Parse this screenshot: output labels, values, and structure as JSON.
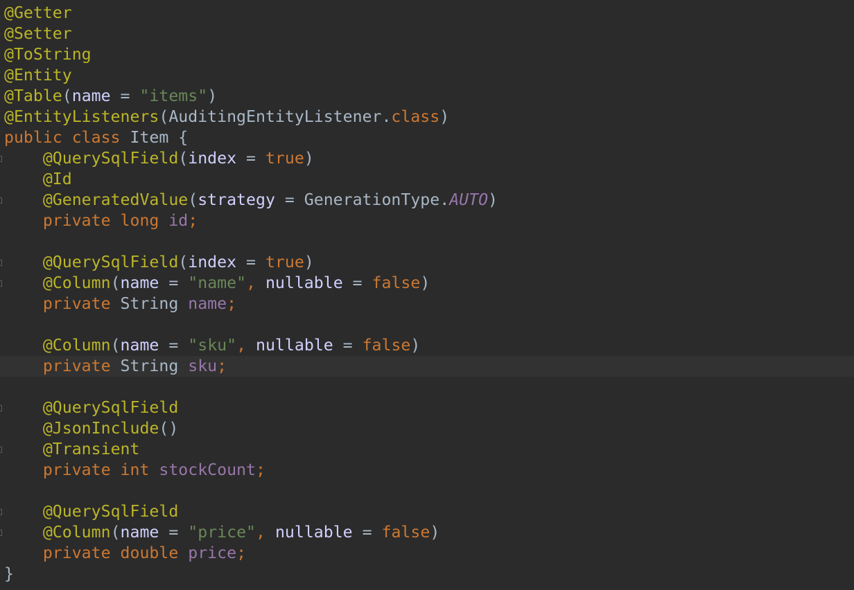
{
  "editor": {
    "lines": [
      {
        "tokens": [
          {
            "t": "@Getter",
            "c": "ann"
          }
        ]
      },
      {
        "tokens": [
          {
            "t": "@Setter",
            "c": "ann"
          }
        ]
      },
      {
        "tokens": [
          {
            "t": "@ToString",
            "c": "ann"
          }
        ]
      },
      {
        "tokens": [
          {
            "t": "@Entity",
            "c": "ann"
          }
        ]
      },
      {
        "tokens": [
          {
            "t": "@Table",
            "c": "ann"
          },
          {
            "t": "(",
            "c": "plain"
          },
          {
            "t": "name",
            "c": "param"
          },
          {
            "t": " = ",
            "c": "plain"
          },
          {
            "t": "\"items\"",
            "c": "str"
          },
          {
            "t": ")",
            "c": "plain"
          }
        ]
      },
      {
        "tokens": [
          {
            "t": "@EntityListeners",
            "c": "ann"
          },
          {
            "t": "(AuditingEntityListener.",
            "c": "plain"
          },
          {
            "t": "class",
            "c": "kw"
          },
          {
            "t": ")",
            "c": "plain"
          }
        ]
      },
      {
        "tokens": [
          {
            "t": "public class ",
            "c": "kw"
          },
          {
            "t": "Item {",
            "c": "plain"
          }
        ]
      },
      {
        "fold": true,
        "tokens": [
          {
            "t": "    ",
            "c": "plain"
          },
          {
            "t": "@QuerySqlField",
            "c": "ann"
          },
          {
            "t": "(",
            "c": "plain"
          },
          {
            "t": "index",
            "c": "param"
          },
          {
            "t": " = ",
            "c": "plain"
          },
          {
            "t": "true",
            "c": "kw"
          },
          {
            "t": ")",
            "c": "plain"
          }
        ]
      },
      {
        "tokens": [
          {
            "t": "    ",
            "c": "plain"
          },
          {
            "t": "@Id",
            "c": "ann"
          }
        ]
      },
      {
        "fold": true,
        "tokens": [
          {
            "t": "    ",
            "c": "plain"
          },
          {
            "t": "@GeneratedValue",
            "c": "ann"
          },
          {
            "t": "(",
            "c": "plain"
          },
          {
            "t": "strategy",
            "c": "param"
          },
          {
            "t": " = GenerationType.",
            "c": "plain"
          },
          {
            "t": "AUTO",
            "c": "const"
          },
          {
            "t": ")",
            "c": "plain"
          }
        ]
      },
      {
        "tokens": [
          {
            "t": "    ",
            "c": "plain"
          },
          {
            "t": "private long ",
            "c": "kw"
          },
          {
            "t": "id",
            "c": "fld"
          },
          {
            "t": ";",
            "c": "kw"
          }
        ]
      },
      {
        "tokens": []
      },
      {
        "fold": true,
        "tokens": [
          {
            "t": "    ",
            "c": "plain"
          },
          {
            "t": "@QuerySqlField",
            "c": "ann"
          },
          {
            "t": "(",
            "c": "plain"
          },
          {
            "t": "index",
            "c": "param"
          },
          {
            "t": " = ",
            "c": "plain"
          },
          {
            "t": "true",
            "c": "kw"
          },
          {
            "t": ")",
            "c": "plain"
          }
        ]
      },
      {
        "fold": true,
        "tokens": [
          {
            "t": "    ",
            "c": "plain"
          },
          {
            "t": "@Column",
            "c": "ann"
          },
          {
            "t": "(",
            "c": "plain"
          },
          {
            "t": "name",
            "c": "param"
          },
          {
            "t": " = ",
            "c": "plain"
          },
          {
            "t": "\"name\"",
            "c": "str"
          },
          {
            "t": ", ",
            "c": "kw"
          },
          {
            "t": "nullable",
            "c": "param"
          },
          {
            "t": " = ",
            "c": "plain"
          },
          {
            "t": "false",
            "c": "kw"
          },
          {
            "t": ")",
            "c": "plain"
          }
        ]
      },
      {
        "tokens": [
          {
            "t": "    ",
            "c": "plain"
          },
          {
            "t": "private ",
            "c": "kw"
          },
          {
            "t": "String ",
            "c": "plain"
          },
          {
            "t": "name",
            "c": "fld"
          },
          {
            "t": ";",
            "c": "kw"
          }
        ]
      },
      {
        "tokens": []
      },
      {
        "tokens": [
          {
            "t": "    ",
            "c": "plain"
          },
          {
            "t": "@Column",
            "c": "ann"
          },
          {
            "t": "(",
            "c": "plain"
          },
          {
            "t": "name",
            "c": "param"
          },
          {
            "t": " = ",
            "c": "plain"
          },
          {
            "t": "\"sku\"",
            "c": "str"
          },
          {
            "t": ", ",
            "c": "kw"
          },
          {
            "t": "nullable",
            "c": "param"
          },
          {
            "t": " = ",
            "c": "plain"
          },
          {
            "t": "false",
            "c": "kw"
          },
          {
            "t": ")",
            "c": "plain"
          }
        ]
      },
      {
        "current": true,
        "tokens": [
          {
            "t": "    ",
            "c": "plain"
          },
          {
            "t": "private ",
            "c": "kw"
          },
          {
            "t": "String ",
            "c": "plain"
          },
          {
            "t": "sku",
            "c": "fld"
          },
          {
            "t": ";",
            "c": "kw"
          }
        ]
      },
      {
        "tokens": []
      },
      {
        "fold": true,
        "tokens": [
          {
            "t": "    ",
            "c": "plain"
          },
          {
            "t": "@QuerySqlField",
            "c": "ann"
          }
        ]
      },
      {
        "tokens": [
          {
            "t": "    ",
            "c": "plain"
          },
          {
            "t": "@JsonInclude",
            "c": "ann"
          },
          {
            "t": "()",
            "c": "plain"
          }
        ]
      },
      {
        "fold": true,
        "tokens": [
          {
            "t": "    ",
            "c": "plain"
          },
          {
            "t": "@Transient",
            "c": "ann"
          }
        ]
      },
      {
        "tokens": [
          {
            "t": "    ",
            "c": "plain"
          },
          {
            "t": "private int ",
            "c": "kw"
          },
          {
            "t": "stockCount",
            "c": "fld"
          },
          {
            "t": ";",
            "c": "kw"
          }
        ]
      },
      {
        "tokens": []
      },
      {
        "fold": true,
        "tokens": [
          {
            "t": "    ",
            "c": "plain"
          },
          {
            "t": "@QuerySqlField",
            "c": "ann"
          }
        ]
      },
      {
        "fold": true,
        "tokens": [
          {
            "t": "    ",
            "c": "plain"
          },
          {
            "t": "@Column",
            "c": "ann"
          },
          {
            "t": "(",
            "c": "plain"
          },
          {
            "t": "name",
            "c": "param"
          },
          {
            "t": " = ",
            "c": "plain"
          },
          {
            "t": "\"price\"",
            "c": "str"
          },
          {
            "t": ", ",
            "c": "kw"
          },
          {
            "t": "nullable",
            "c": "param"
          },
          {
            "t": " = ",
            "c": "plain"
          },
          {
            "t": "false",
            "c": "kw"
          },
          {
            "t": ")",
            "c": "plain"
          }
        ]
      },
      {
        "tokens": [
          {
            "t": "    ",
            "c": "plain"
          },
          {
            "t": "private double ",
            "c": "kw"
          },
          {
            "t": "price",
            "c": "fld"
          },
          {
            "t": ";",
            "c": "kw"
          }
        ]
      },
      {
        "tokens": [
          {
            "t": "}",
            "c": "plain"
          }
        ]
      }
    ]
  }
}
